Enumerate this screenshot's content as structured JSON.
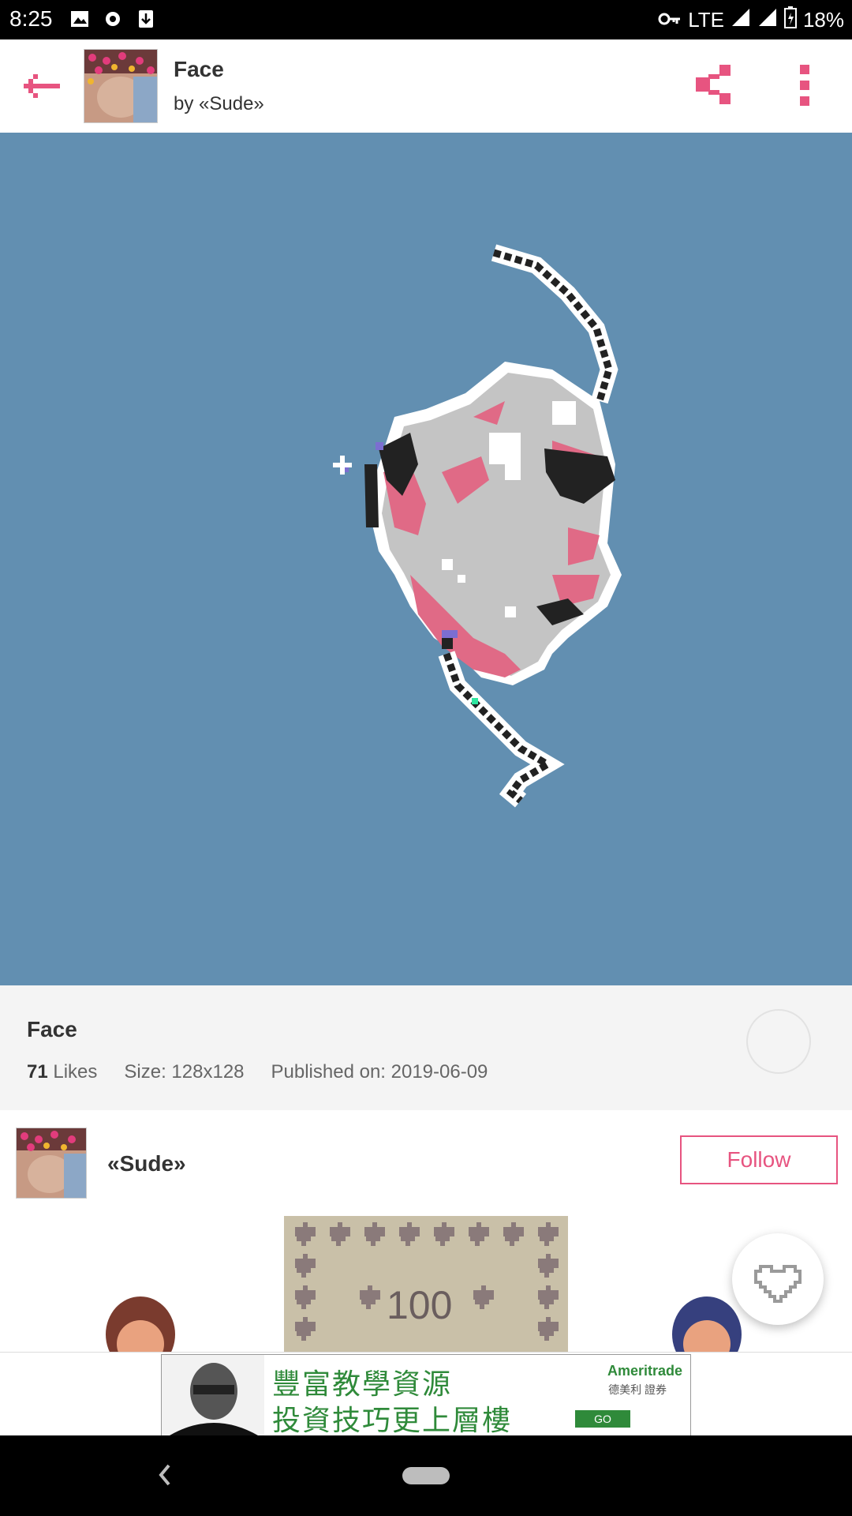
{
  "status": {
    "time": "8:25",
    "network": "LTE",
    "battery": "18%"
  },
  "appbar": {
    "title": "Face",
    "author": "by «Sude»"
  },
  "info": {
    "title": "Face",
    "likes_count": "71",
    "likes_label": "Likes",
    "size": "Size: 128x128",
    "published": "Published on: 2019-06-09"
  },
  "author_row": {
    "name": "«Sude»",
    "follow_label": "Follow"
  },
  "gallery": {
    "card_text": "100"
  },
  "ad": {
    "line1": "豐富教學資源",
    "line2": "投資技巧更上層樓",
    "brand": "Ameritrade",
    "brand_sub": "德美利 證券",
    "go": "GO"
  },
  "colors": {
    "accent": "#e75480",
    "canvas_bg": "#628fb1"
  }
}
